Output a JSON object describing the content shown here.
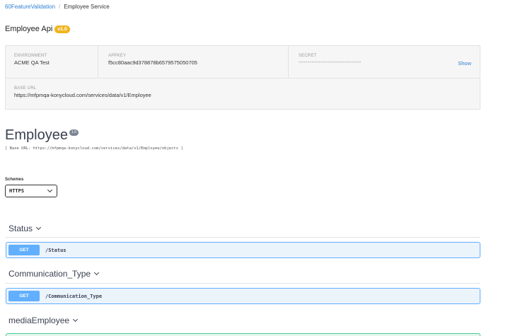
{
  "breadcrumb": {
    "parent": "60FeatureValidation",
    "separator": "/",
    "current": "Employee Service"
  },
  "api": {
    "title": "Employee Api",
    "version": "v1.0"
  },
  "info": {
    "environment_label": "ENVIRONMENT",
    "environment_value": "ACME QA Test",
    "appkey_label": "APPKEY",
    "appkey_value": "f5cc80aac9d378878b6579575050705",
    "secret_label": "SECRET",
    "secret_value": "••••••••••••••••••••••••••••••••••",
    "show_label": "Show",
    "baseurl_label": "BASE URL",
    "baseurl_value": "https://mfpmqa-konycloud.com/services/data/v1/Employee"
  },
  "section": {
    "title": "Employee",
    "version": "1.0",
    "base_url": "[ Base URL: https://mfpmqa-konycloud.com/services/data/v1/Employee/objects ]"
  },
  "schemes": {
    "label": "Schemes",
    "selected": "HTTPS"
  },
  "tags": [
    {
      "name": "Status",
      "method": "GET",
      "path": "/Status"
    },
    {
      "name": "Communication_Type",
      "method": "GET",
      "path": "/Communication_Type"
    },
    {
      "name": "mediaEmployee"
    }
  ],
  "colors": {
    "get": "#61affe",
    "post": "#49cc90",
    "link": "#2f80d1",
    "badge": "#f0b41e"
  }
}
